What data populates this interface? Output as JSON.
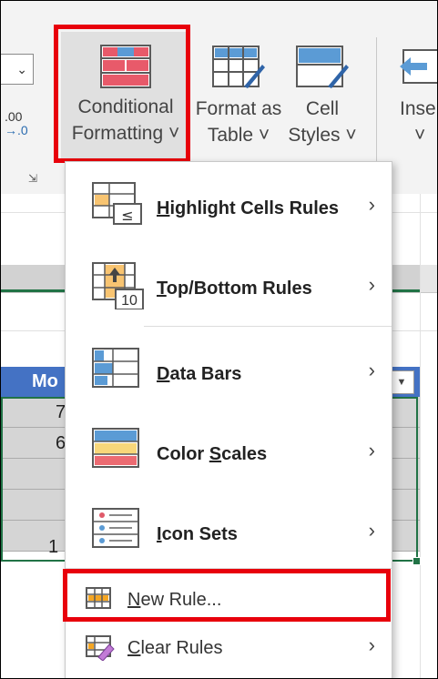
{
  "ribbon": {
    "number_format_glyph": ".00",
    "number_format_glyph2": "→.0",
    "conditional_formatting": {
      "line1": "Conditional",
      "line2": "Formatting ˅"
    },
    "format_as_table": {
      "line1": "Format as",
      "line2": "Table ˅"
    },
    "cell_styles": {
      "line1": "Cell",
      "line2": "Styles ˅"
    },
    "insert": {
      "line1": "Inse",
      "line2": "˅"
    }
  },
  "sheet": {
    "table_header": "Mo",
    "values": [
      "7",
      "6",
      "",
      "",
      "1"
    ]
  },
  "menu": {
    "items": [
      {
        "label": "Highlight Cells Rules",
        "has_submenu": true
      },
      {
        "label": "Top/Bottom Rules",
        "has_submenu": true
      },
      {
        "label": "Data Bars",
        "has_submenu": true
      },
      {
        "label": "Color Scales",
        "has_submenu": true
      },
      {
        "label": "Icon Sets",
        "has_submenu": true
      },
      {
        "label": "New Rule...",
        "has_submenu": false
      },
      {
        "label": "Clear Rules",
        "has_submenu": true
      }
    ],
    "topbottom_icon_number": "10"
  },
  "colors": {
    "highlight_red": "#e8000b",
    "table_blue": "#4472c4",
    "excel_green": "#217346"
  }
}
